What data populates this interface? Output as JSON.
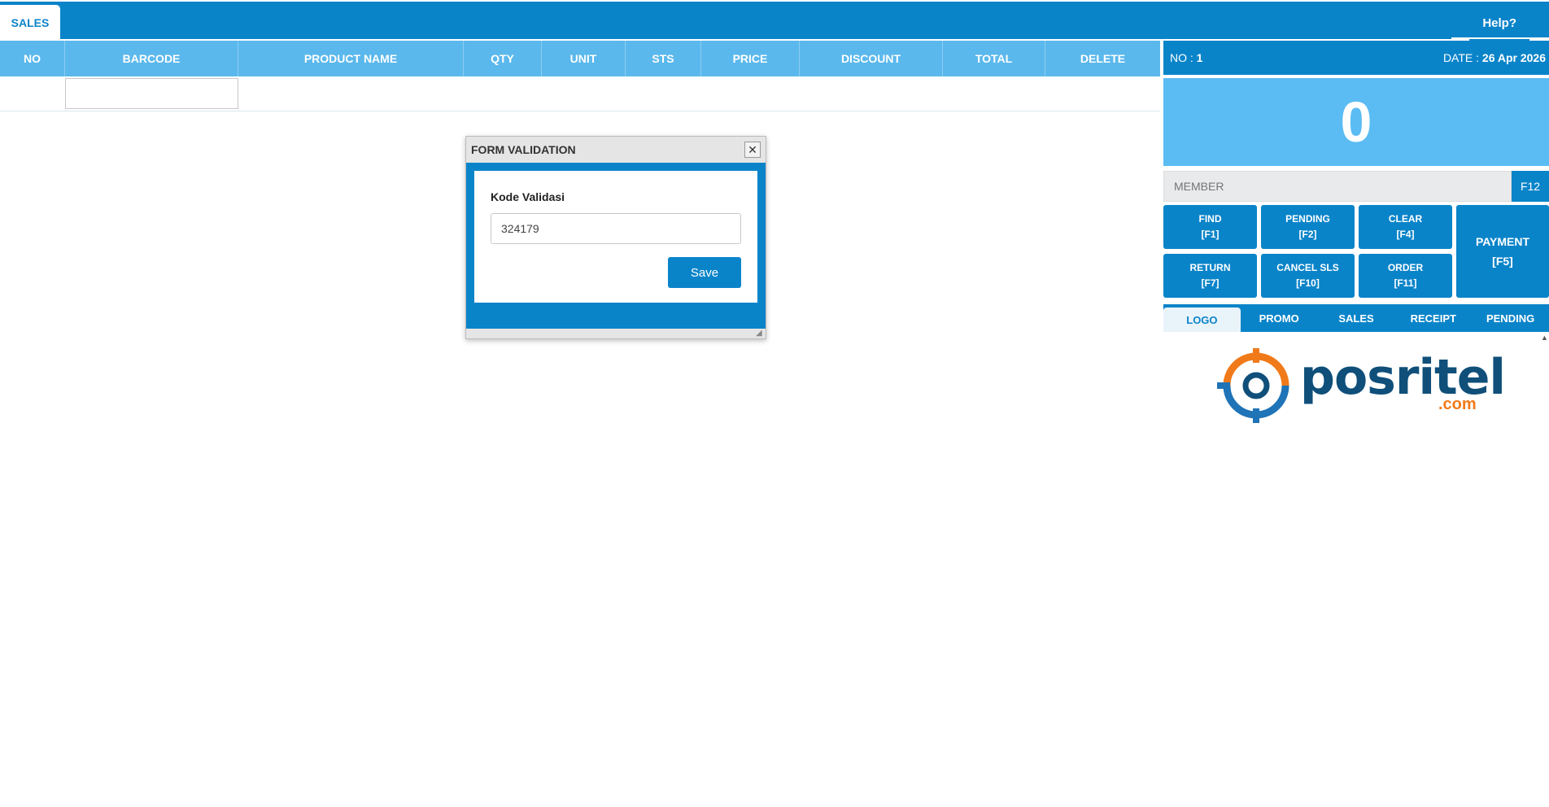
{
  "topbar": {
    "tab_label": "SALES",
    "help_label": "Help?"
  },
  "grid": {
    "columns": [
      "NO",
      "BARCODE",
      "PRODUCT NAME",
      "QTY",
      "UNIT",
      "STS",
      "PRICE",
      "DISCOUNT",
      "TOTAL",
      "DELETE"
    ],
    "barcode_value": ""
  },
  "panel": {
    "no_label": "NO :",
    "no_value": "1",
    "date_label": "DATE :",
    "date_value": "26 Apr 2026",
    "total": "0",
    "member_placeholder": "MEMBER",
    "member_key": "F12",
    "buttons": {
      "find": {
        "label": "FIND",
        "key": "[F1]"
      },
      "pending": {
        "label": "PENDING",
        "key": "[F2]"
      },
      "clear": {
        "label": "CLEAR",
        "key": "[F4]"
      },
      "payment": {
        "label": "PAYMENT",
        "key": "[F5]"
      },
      "return": {
        "label": "RETURN",
        "key": "[F7]"
      },
      "cancel": {
        "label": "CANCEL SLS",
        "key": "[F10]"
      },
      "order": {
        "label": "ORDER",
        "key": "[F11]"
      }
    },
    "tabs": [
      "LOGO",
      "PROMO",
      "SALES",
      "RECEIPT",
      "PENDING"
    ],
    "active_tab": "LOGO"
  },
  "logo": {
    "text": "posritel",
    "suffix": ".com",
    "colors": {
      "blue": "#0f4f7a",
      "orange": "#f07a1a"
    }
  },
  "modal": {
    "title": "FORM VALIDATION",
    "field_label": "Kode Validasi",
    "field_value": "324179",
    "save_label": "Save"
  },
  "colors": {
    "primary": "#0a84c9",
    "header_light": "#5bb8ec",
    "total_bg": "#5bbcf3"
  }
}
